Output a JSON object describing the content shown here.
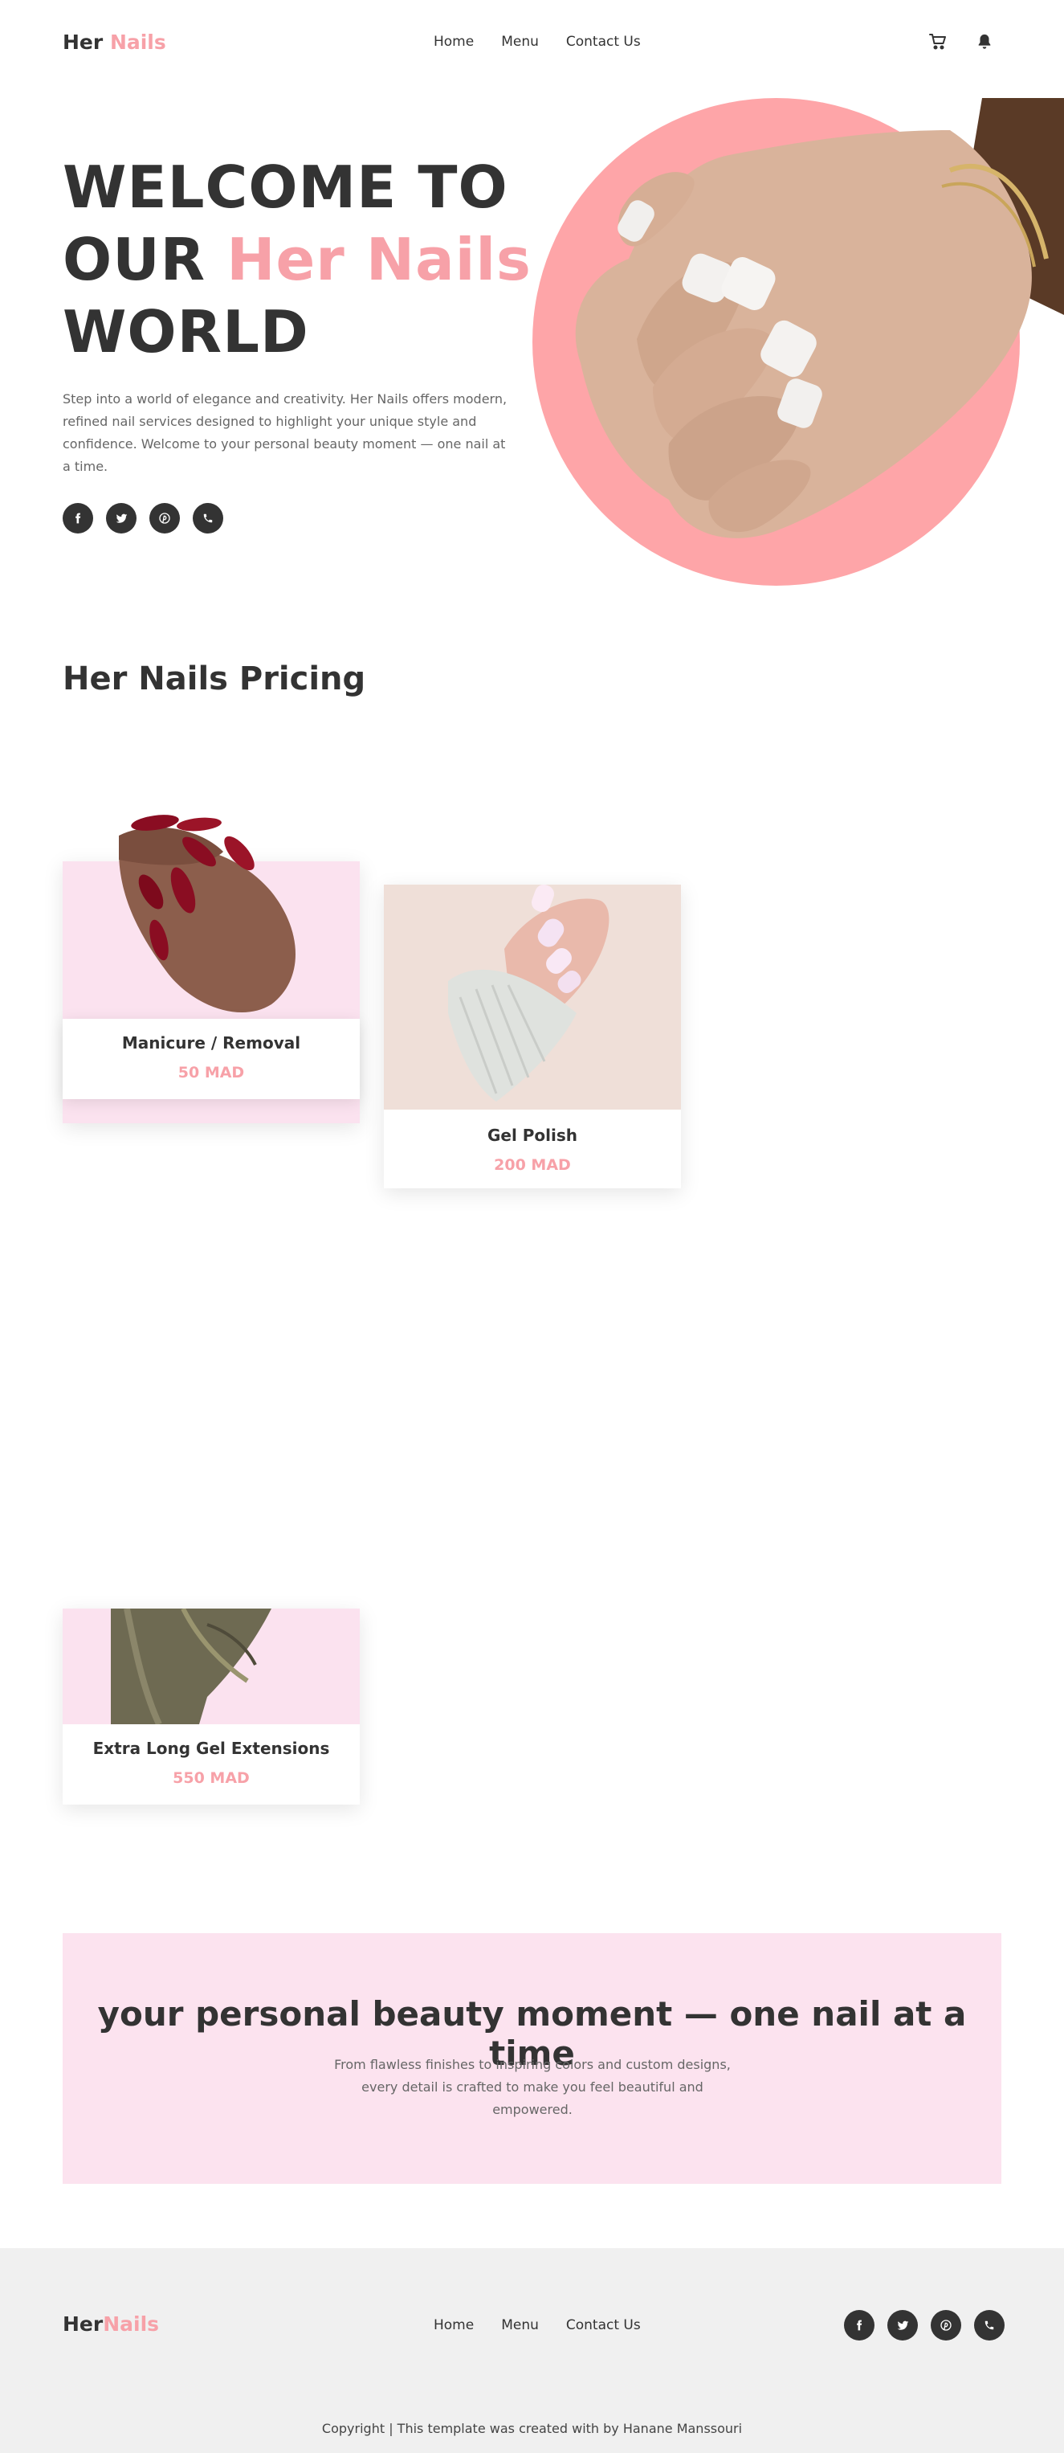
{
  "nav": {
    "logo_main": "Her",
    "logo_accent": "Nails",
    "links": [
      "Home",
      "Menu",
      "Contact Us"
    ],
    "icons": [
      "cart-icon",
      "bell-icon"
    ]
  },
  "hero": {
    "title_line1": "WELCOME TO",
    "title_line2_prefix": "OUR ",
    "title_line2_accent": "Her Nails",
    "title_line3": "WORLD",
    "description": "Step into a world of elegance and creativity. Her Nails offers modern, refined nail services designed to highlight your unique style and confidence. Welcome to your personal beauty moment — one nail at a time.",
    "socials": [
      "facebook-icon",
      "twitter-icon",
      "pinterest-icon",
      "phone-icon"
    ]
  },
  "pricing": {
    "title": "Her Nails Pricing",
    "items": [
      {
        "name": "Manicure / Removal",
        "price": "50 MAD"
      },
      {
        "name": "Gel Polish",
        "price": "200 MAD"
      },
      {
        "name": "Extra Long Gel Extensions",
        "price": "550 MAD"
      }
    ]
  },
  "banner": {
    "title": "your personal beauty moment — one nail at a time",
    "text": "From flawless finishes to inspiring colors and custom designs, every detail is crafted to make you feel beautiful and empowered."
  },
  "footer": {
    "logo_main": "Her",
    "logo_accent": "Nails",
    "links": [
      "Home",
      "Menu",
      "Contact Us"
    ],
    "copyright": "Copyright | This template was created with by Hanane Manssouri"
  },
  "colors": {
    "accent": "#f7a1a8",
    "dark": "#333333",
    "banner_bg": "#fce3ef",
    "footer_bg": "#f0f0f0"
  }
}
